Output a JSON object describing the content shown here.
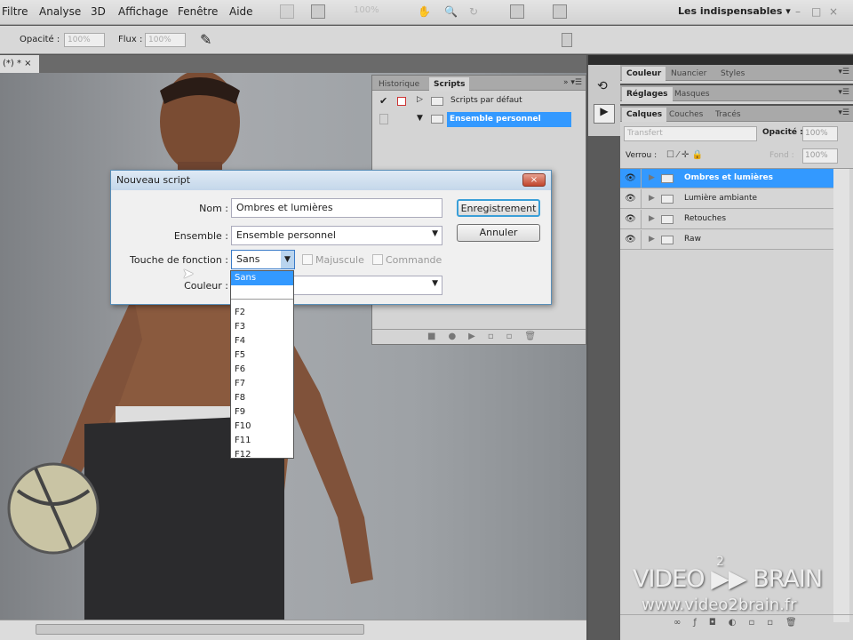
{
  "menubar": {
    "items": [
      "Filtre",
      "Analyse",
      "3D",
      "Affichage",
      "Fenêtre",
      "Aide"
    ],
    "zoom": "100%",
    "workspace": "Les indispensables ▾",
    "window_controls": [
      "–",
      "□",
      "×"
    ]
  },
  "options": {
    "opacity_label": "Opacité :",
    "opacity_value": "100%",
    "flow_label": "Flux :",
    "flow_value": "100%"
  },
  "document_tab": {
    "label": "(*) * ×"
  },
  "panels": {
    "color_tabs": [
      "Couleur",
      "Nuancier",
      "Styles"
    ],
    "adjust_tabs": [
      "Réglages",
      "Masques"
    ],
    "layers_tabs": [
      "Calques",
      "Couches",
      "Tracés"
    ],
    "blend_mode": "Transfert",
    "opacity_label": "Opacité :",
    "opacity_value": "100%",
    "lock_label": "Verrou :",
    "fill_label": "Fond :",
    "fill_value": "100%",
    "layers": [
      {
        "name": "Ombres et lumières",
        "selected": true
      },
      {
        "name": "Lumière ambiante"
      },
      {
        "name": "Retouches"
      },
      {
        "name": "Raw"
      }
    ]
  },
  "scripts_panel": {
    "tabs": [
      "Historique",
      "Scripts"
    ],
    "sets": [
      {
        "name": "Scripts par défaut",
        "expanded": false
      },
      {
        "name": "Ensemble personnel",
        "expanded": true,
        "selected": true
      }
    ]
  },
  "dialog": {
    "title": "Nouveau script",
    "close": "×",
    "name_label": "Nom :",
    "name_value": "Ombres et lumières",
    "set_label": "Ensemble :",
    "set_value": "Ensemble personnel",
    "fkey_label": "Touche de fonction :",
    "fkey_value": "Sans",
    "shift_label": "Majuscule",
    "cmd_label": "Commande",
    "color_label": "Couleur :",
    "record_button": "Enregistrement",
    "cancel_button": "Annuler",
    "fkey_options": [
      "Sans",
      "",
      "F2",
      "F3",
      "F4",
      "F5",
      "F6",
      "F7",
      "F8",
      "F9",
      "F10",
      "F11",
      "F12"
    ]
  },
  "watermark": {
    "brand": "VIDEO ▶▶ BRAIN",
    "sup": "2",
    "url": "www.video2brain.fr"
  }
}
